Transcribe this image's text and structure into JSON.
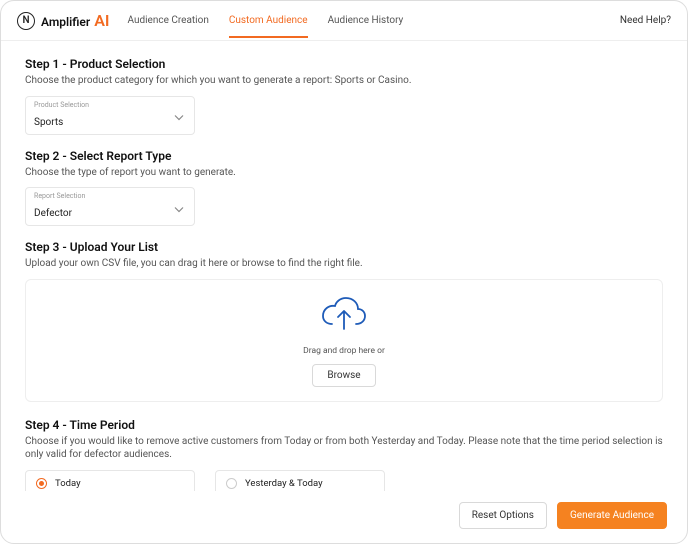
{
  "brand": {
    "name": "Amplifier",
    "suffix": "AI"
  },
  "tabs": [
    {
      "label": "Audience Creation"
    },
    {
      "label": "Custom Audience"
    },
    {
      "label": "Audience History"
    }
  ],
  "help_label": "Need Help?",
  "step1": {
    "title": "Step 1 - Product Selection",
    "desc": "Choose the product category for which you want to generate a report: Sports or Casino.",
    "select_label": "Product Selection",
    "select_value": "Sports"
  },
  "step2": {
    "title": "Step 2 - Select Report Type",
    "desc": "Choose the type of report you want to generate.",
    "select_label": "Report Selection",
    "select_value": "Defector"
  },
  "step3": {
    "title": "Step 3 - Upload Your List",
    "desc": "Upload your own CSV file, you can drag it here or browse to find the right file.",
    "drop_text": "Drag and drop here or",
    "browse_label": "Browse"
  },
  "step4": {
    "title": "Step 4 - Time Period",
    "desc": "Choose if you would like to remove active customers from Today or from both Yesterday and Today. Please note that the time period selection is only valid for defector audiences.",
    "options": [
      {
        "label": "Today"
      },
      {
        "label": "Yesterday & Today"
      }
    ]
  },
  "footer": {
    "reset_label": "Reset Options",
    "generate_label": "Generate Audience"
  }
}
